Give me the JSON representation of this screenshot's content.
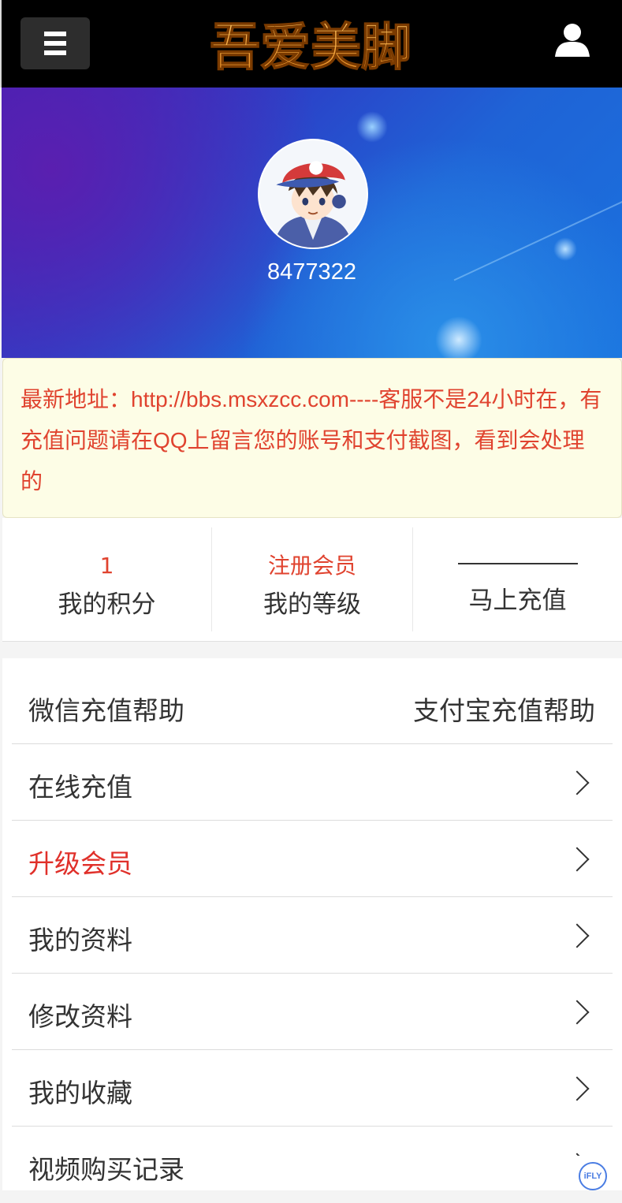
{
  "header": {
    "menu_icon": "hamburger-menu-icon",
    "logo_text": "吾爱美脚",
    "user_icon": "user-icon"
  },
  "profile": {
    "username": "8477322",
    "avatar_icon": "cartoon-avatar"
  },
  "notice": {
    "text": "最新地址：http://bbs.msxzcc.com----客服不是24小时在，有充值问题请在QQ上留言您的账号和支付截图，看到会处理的"
  },
  "stats": [
    {
      "value": "1",
      "label": "我的积分"
    },
    {
      "value": "注册会员",
      "label": "我的等级"
    },
    {
      "value": "",
      "label": "马上充值"
    }
  ],
  "menu": {
    "help_left": "微信充值帮助",
    "help_right": "支付宝充值帮助",
    "items": [
      {
        "label": "在线充值"
      },
      {
        "label": "升级会员"
      },
      {
        "label": "我的资料"
      },
      {
        "label": "修改资料"
      },
      {
        "label": "我的收藏"
      },
      {
        "label": "视频购买记录"
      }
    ]
  },
  "badge": {
    "text": "iFLY"
  },
  "colors": {
    "accent_red": "#e0432f",
    "header_bg": "#000000",
    "notice_bg": "#fdfde6"
  }
}
